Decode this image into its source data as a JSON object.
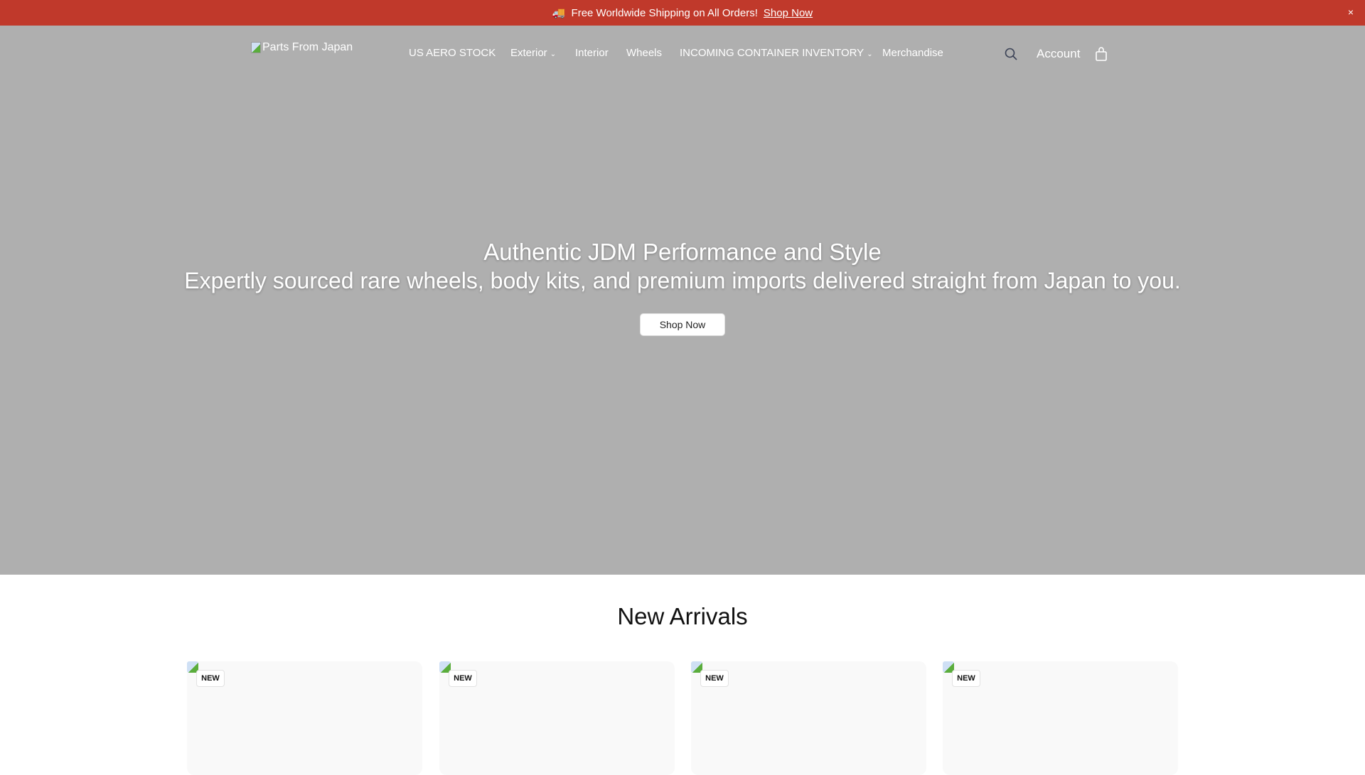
{
  "announcement": {
    "emoji": "🚚",
    "text": "Free Worldwide Shipping on All Orders!",
    "link": "Shop Now",
    "close": "×"
  },
  "header": {
    "logo_alt": "Parts From Japan",
    "nav": [
      {
        "label": "US AERO STOCK",
        "dropdown": false
      },
      {
        "label": "Exterior",
        "dropdown": true
      },
      {
        "label": "Interior",
        "dropdown": false
      },
      {
        "label": "Wheels",
        "dropdown": false
      },
      {
        "label": "INCOMING CONTAINER INVENTORY",
        "dropdown": true
      },
      {
        "label": "Merchandise",
        "dropdown": false
      }
    ],
    "chevron": "⌄",
    "account": "Account"
  },
  "hero": {
    "title": "Authentic JDM Performance and Style",
    "subtitle": "Expertly sourced rare wheels, body kits, and premium imports delivered straight from Japan to you.",
    "button": "Shop Now"
  },
  "new_arrivals": {
    "title": "New Arrivals",
    "badge": "NEW",
    "count": 4
  },
  "colors": {
    "announcement_bg": "#c0392b",
    "hero_bg": "#afafaf"
  }
}
